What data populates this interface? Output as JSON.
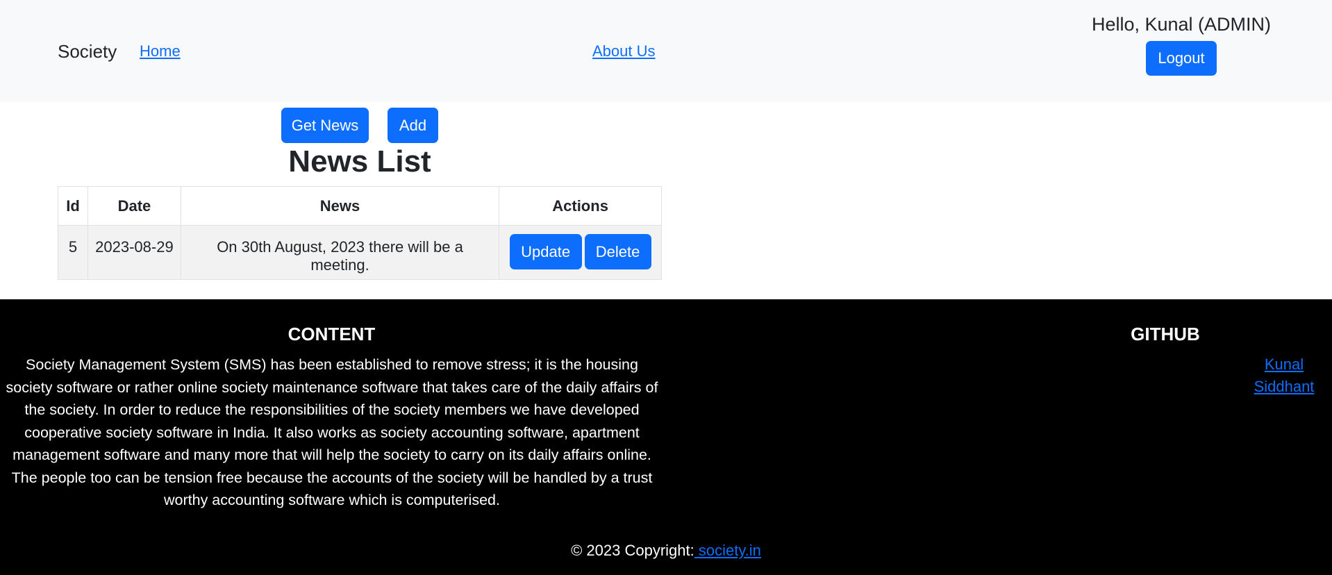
{
  "navbar": {
    "brand": "Society",
    "links": [
      "Home",
      "About Us"
    ],
    "greeting": "Hello, Kunal (ADMIN)",
    "logout_label": "Logout"
  },
  "toolbar": {
    "get_news_label": "Get News",
    "add_label": "Add"
  },
  "page_title": "News List",
  "table": {
    "headers": [
      "Id",
      "Date",
      "News",
      "Actions"
    ],
    "rows": [
      {
        "id": "5",
        "date": "2023-08-29",
        "news": "On 30th August, 2023 there will be a meeting.",
        "update_label": "Update",
        "delete_label": "Delete"
      }
    ]
  },
  "footer": {
    "content_heading": "CONTENT",
    "content_text": "Society Management System (SMS) has been established to remove stress; it is the housing society software or rather online society maintenance software that takes care of the daily affairs of the society. In order to reduce the responsibilities of the society members we have developed cooperative society software in India. It also works as society accounting software, apartment management software and many more that will help the society to carry on its daily affairs online. The people too can be tension free because the accounts of the society will be handled by a trust worthy accounting software which is computerised.",
    "github_heading": "GITHUB",
    "github_links": [
      "Kunal",
      "Siddhant"
    ],
    "copyright_prefix": "© 2023 Copyright:",
    "copyright_link": " society.in"
  },
  "colors": {
    "primary": "#0d6efd",
    "navbar_bg": "#f8f9fa",
    "footer_bg": "#000000",
    "row_bg": "#f2f2f2"
  }
}
